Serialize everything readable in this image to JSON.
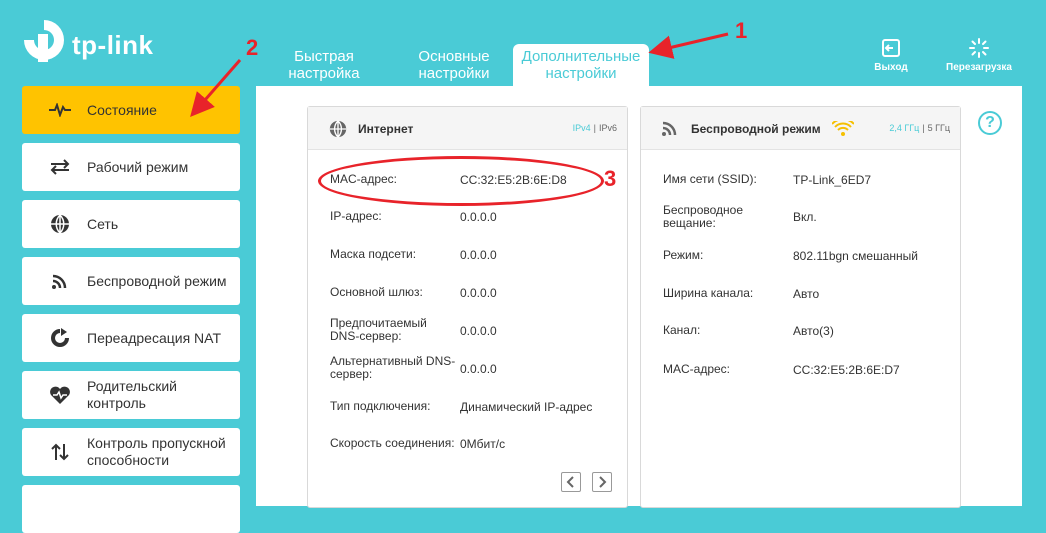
{
  "brand": {
    "name": "tp-link"
  },
  "tabs": [
    {
      "line1": "Быстрая",
      "line2": "настройка"
    },
    {
      "line1": "Основные",
      "line2": "настройки"
    },
    {
      "line1": "Дополнительные",
      "line2": "настройки"
    }
  ],
  "top_actions": {
    "logout": "Выход",
    "reboot": "Перезагрузка"
  },
  "sidebar": {
    "items": [
      {
        "label": "Состояние",
        "icon": "pulse-icon"
      },
      {
        "label": "Рабочий режим",
        "icon": "switch-arrows-icon"
      },
      {
        "label": "Сеть",
        "icon": "globe-icon"
      },
      {
        "label": "Беспроводной режим",
        "icon": "wifi-icon"
      },
      {
        "label": "Переадресация NAT",
        "icon": "refresh-icon"
      },
      {
        "label1": "Родительский",
        "label2": "контроль",
        "icon": "heart-icon"
      },
      {
        "label1": "Контроль пропускной",
        "label2": "способности",
        "icon": "updown-arrows-icon"
      }
    ]
  },
  "internet": {
    "title": "Интернет",
    "ipv4": "IPv4",
    "ipv6": "IPv6",
    "rows": [
      {
        "label": "MAC-адрес:",
        "value": "CC:32:E5:2B:6E:D8"
      },
      {
        "label": "IP-адрес:",
        "value": "0.0.0.0"
      },
      {
        "label": "Маска подсети:",
        "value": "0.0.0.0"
      },
      {
        "label": "Основной шлюз:",
        "value": "0.0.0.0"
      },
      {
        "label1": "Предпочитаемый",
        "label2": "DNS-сервер:",
        "value": "0.0.0.0"
      },
      {
        "label1": "Альтернативный DNS-",
        "label2": "сервер:",
        "value": "0.0.0.0"
      },
      {
        "label": "Тип подключения:",
        "value": "Динамический IP-адрес"
      },
      {
        "label": "Скорость соединения:",
        "value": "0Мбит/с"
      }
    ]
  },
  "wireless": {
    "title": "Беспроводной режим",
    "band24": "2,4 ГГц",
    "band5": "5 ГГц",
    "rows": [
      {
        "label": "Имя сети (SSID):",
        "value": "TP-Link_6ED7"
      },
      {
        "label1": "Беспроводное",
        "label2": "вещание:",
        "value": "Вкл."
      },
      {
        "label": "Режим:",
        "value": "802.11bgn смешанный"
      },
      {
        "label": "Ширина канала:",
        "value": "Авто"
      },
      {
        "label": "Канал:",
        "value": "Авто(3)"
      },
      {
        "label": "MAC-адрес:",
        "value": "CC:32:E5:2B:6E:D7"
      }
    ]
  },
  "help": "?",
  "annotations": {
    "n1": "1",
    "n2": "2",
    "n3": "3"
  },
  "colors": {
    "accent": "#4acbd6",
    "active": "#ffc300",
    "annotation": "#e8232a"
  }
}
